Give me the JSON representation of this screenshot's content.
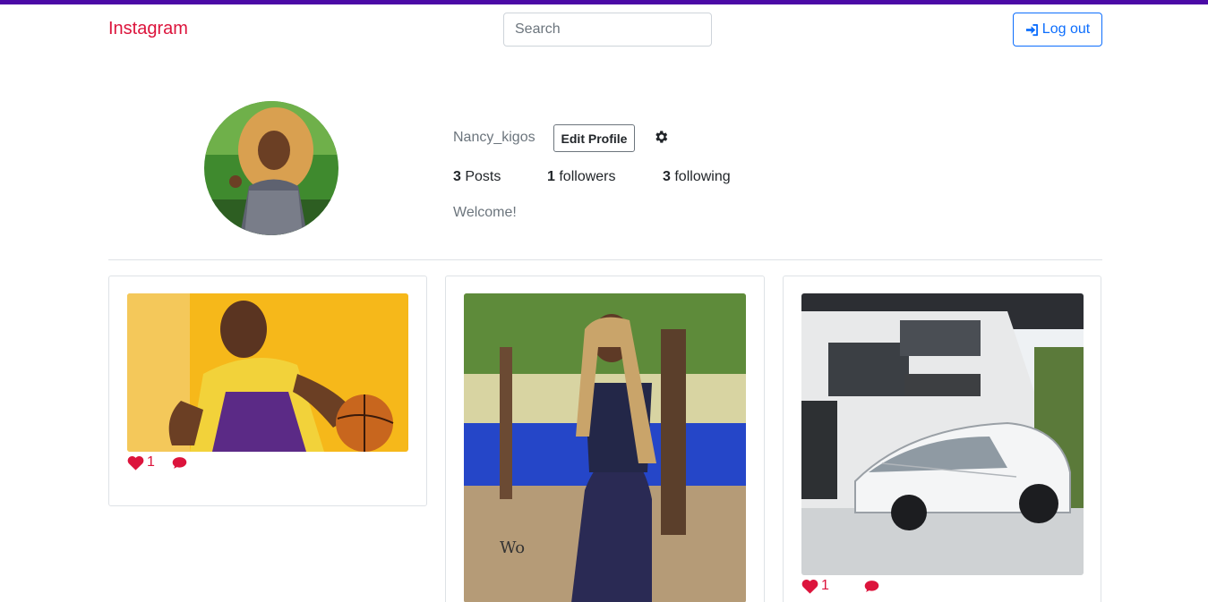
{
  "nav": {
    "brand": "Instagram",
    "search_placeholder": "Search",
    "logout_label": "Log out"
  },
  "profile": {
    "username": "Nancy_kigos",
    "edit_label": "Edit Profile",
    "posts_count": "3",
    "posts_label": "Posts",
    "followers_count": "1",
    "followers_label": "followers",
    "following_count": "3",
    "following_label": "following",
    "bio": "Welcome!"
  },
  "posts": [
    {
      "image": "basketball-player-photo",
      "likes": "1"
    },
    {
      "image": "woman-portrait-photo",
      "likes": ""
    },
    {
      "image": "house-sports-car-photo",
      "likes": "1"
    }
  ],
  "colors": {
    "accent": "#dc143c",
    "topbar": "#4b0aa6",
    "primary": "#0d6efd"
  }
}
